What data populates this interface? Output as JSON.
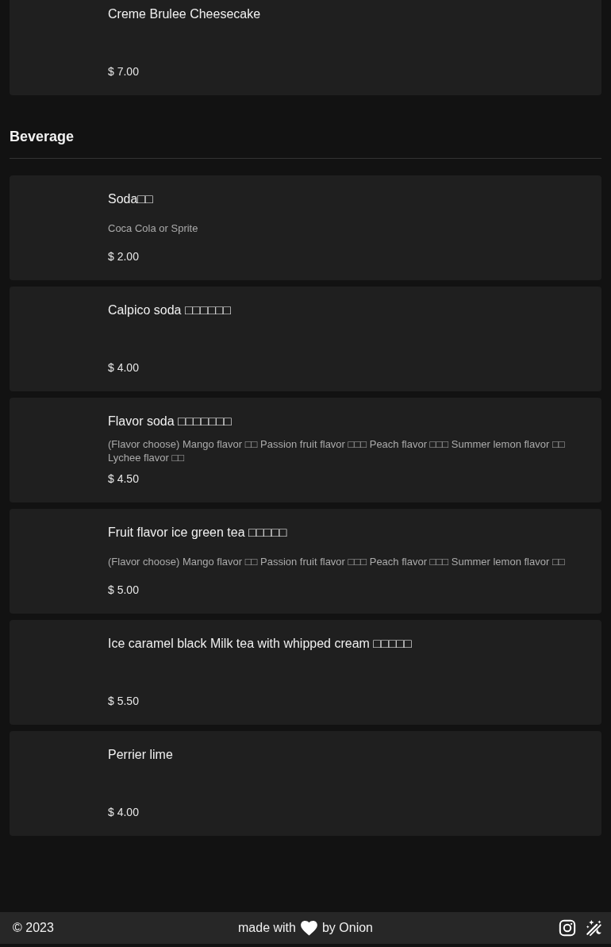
{
  "sections": [
    {
      "items": [
        {
          "name": "Creme Brulee Cheesecake",
          "price": "$ 7.00"
        }
      ]
    },
    {
      "title": "Beverage",
      "items": [
        {
          "name": "Soda□□",
          "description": "Coca Cola or Sprite",
          "price": "$ 2.00"
        },
        {
          "name": "Calpico soda □□□□□□",
          "price": "$ 4.00"
        },
        {
          "name": "Flavor soda □□□□□□□",
          "description": "(Flavor choose) Mango flavor □□ Passion fruit flavor □□□ Peach flavor □□□ Summer lemon flavor □□ Lychee flavor □□",
          "price": "$ 4.50"
        },
        {
          "name": "Fruit flavor ice green tea □□□□□",
          "description": "(Flavor choose) Mango flavor □□ Passion fruit flavor □□□ Peach flavor □□□ Summer lemon flavor □□",
          "price": "$ 5.00"
        },
        {
          "name": "Ice caramel black Milk tea with whipped cream □□□□□",
          "price": "$ 5.50"
        },
        {
          "name": "Perrier lime",
          "price": "$ 4.00"
        }
      ]
    }
  ],
  "footer": {
    "copyright": "© 2023",
    "made_with": "made with",
    "author": "by Onion"
  }
}
